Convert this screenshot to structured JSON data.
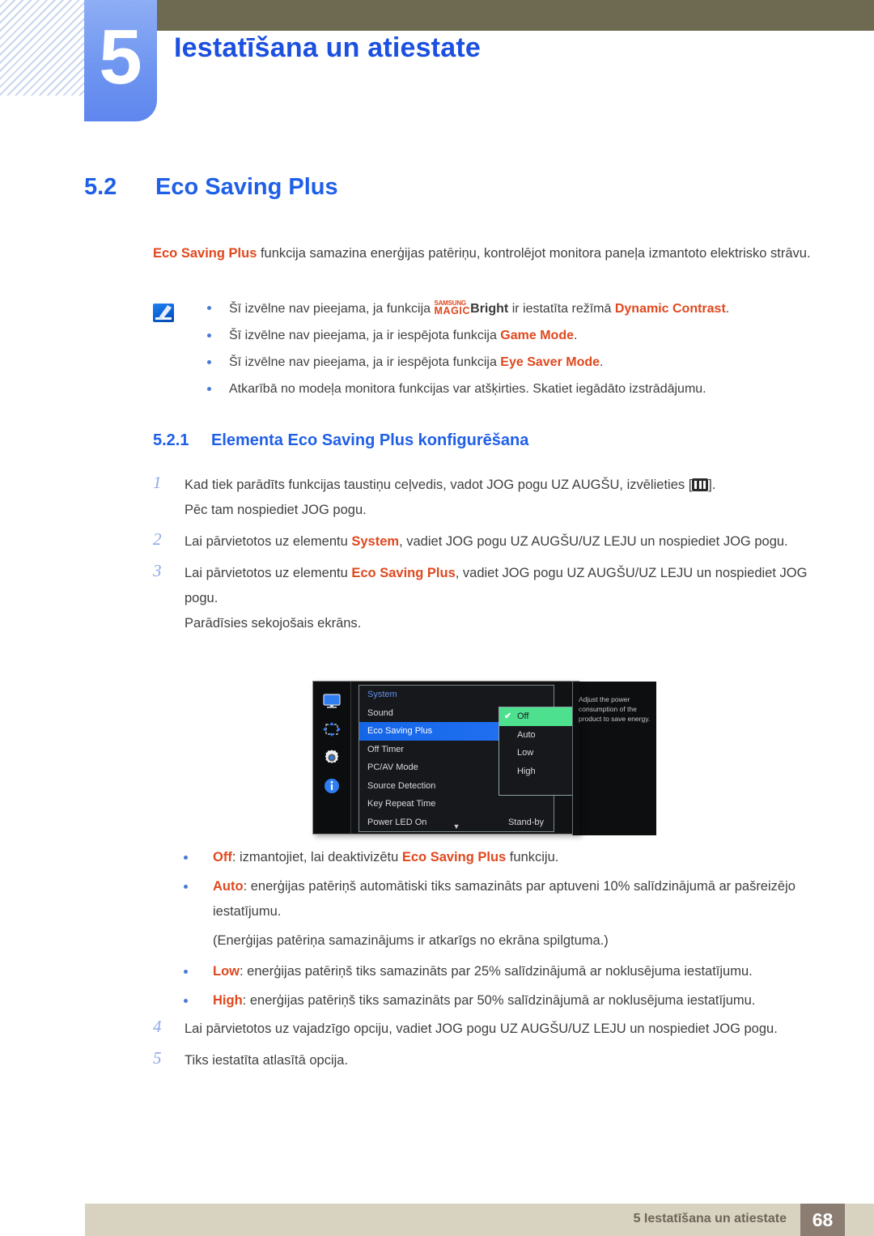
{
  "header": {
    "chapter_number": "5",
    "chapter_title": "Iestatīšana un atiestate"
  },
  "section": {
    "number": "5.2",
    "title": "Eco Saving Plus"
  },
  "intro": {
    "keyword": "Eco Saving Plus",
    "rest": " funkcija samazina enerģijas patēriņu, kontrolējot monitora paneļa izmantoto elektrisko strāvu."
  },
  "notes": [
    {
      "pre": "Šī izvēlne nav pieejama, ja funkcija ",
      "logo_top": "SAMSUNG",
      "logo_bottom": "MAGIC",
      "logo_suffix": "Bright",
      "mid": " ir iestatīta režīmā ",
      "kw": "Dynamic Contrast",
      "post": "."
    },
    {
      "pre": "Šī izvēlne nav pieejama, ja ir iespējota funkcija ",
      "kw": "Game Mode",
      "post": "."
    },
    {
      "pre": "Šī izvēlne nav pieejama, ja ir iespējota funkcija ",
      "kw": "Eye Saver Mode",
      "post": "."
    },
    {
      "pre": "Atkarībā no modeļa monitora funkcijas var atšķirties. Skatiet iegādāto izstrādājumu.",
      "kw": "",
      "post": ""
    }
  ],
  "subsection": {
    "number": "5.2.1",
    "title": "Elementa Eco Saving Plus konfigurēšana"
  },
  "steps": [
    {
      "index": "1",
      "pre": "Kad tiek parādīts funkcijas taustiņu ceļvedis, vadot JOG pogu UZ AUGŠU, izvēlieties [",
      "kw": "",
      "post": "].",
      "has_glyph": true,
      "extra": "Pēc tam nospiediet JOG pogu."
    },
    {
      "index": "2",
      "pre": "Lai pārvietotos uz elementu ",
      "kw": "System",
      "post": ", vadiet JOG pogu UZ AUGŠU/UZ LEJU un nospiediet JOG pogu.",
      "has_glyph": false,
      "extra": ""
    },
    {
      "index": "3",
      "pre": "Lai pārvietotos uz elementu ",
      "kw": "Eco Saving Plus",
      "post": ", vadiet JOG pogu UZ AUGŠU/UZ LEJU un nospiediet JOG pogu.",
      "has_glyph": false,
      "extra": "Parādīsies sekojošais ekrāns."
    }
  ],
  "osd": {
    "rail_icons": [
      "monitor-icon",
      "move-arrows-icon",
      "gear-icon",
      "info-icon"
    ],
    "menu_header": "System",
    "rows": [
      {
        "label": "Sound",
        "value": "",
        "active": false
      },
      {
        "label": "Eco Saving Plus",
        "value": "",
        "active": true
      },
      {
        "label": "Off Timer",
        "value": "",
        "active": false
      },
      {
        "label": "PC/AV Mode",
        "value": "",
        "active": false
      },
      {
        "label": "Source Detection",
        "value": "",
        "active": false
      },
      {
        "label": "Key Repeat Time",
        "value": "",
        "active": false
      },
      {
        "label": "Power LED On",
        "value": "Stand-by",
        "active": false
      }
    ],
    "scroll_indicator": "▼",
    "submenu": [
      {
        "label": "Off",
        "selected": true,
        "check": "✔"
      },
      {
        "label": "Auto",
        "selected": false,
        "check": ""
      },
      {
        "label": "Low",
        "selected": false,
        "check": ""
      },
      {
        "label": "High",
        "selected": false,
        "check": ""
      }
    ],
    "description": "Adjust the power consumption of the product to save energy.",
    "colors": {
      "highlight_blue": "#1f6ff0",
      "selected_green": "#4ce08f",
      "background": "#17181b"
    }
  },
  "options": [
    {
      "kw": "Off",
      "pre": ": izmantojiet, lai deaktivizētu ",
      "kw2": "Eco Saving Plus",
      "post": " funkciju.",
      "sub": ""
    },
    {
      "kw": "Auto",
      "pre": ": enerģijas patēriņš automātiski tiks samazināts par aptuveni 10% salīdzinājumā ar pašreizējo iestatījumu.",
      "kw2": "",
      "post": "",
      "sub": "(Enerģijas patēriņa samazinājums ir atkarīgs no ekrāna spilgtuma.)"
    },
    {
      "kw": "Low",
      "pre": ": enerģijas patēriņš tiks samazināts par 25% salīdzinājumā ar noklusējuma iestatījumu.",
      "kw2": "",
      "post": "",
      "sub": ""
    },
    {
      "kw": "High",
      "pre": ": enerģijas patēriņš tiks samazināts par 50% salīdzinājumā ar noklusējuma iestatījumu.",
      "kw2": "",
      "post": "",
      "sub": ""
    }
  ],
  "steps_end": [
    {
      "index": "4",
      "text": "Lai pārvietotos uz vajadzīgo opciju, vadiet JOG pogu UZ AUGŠU/UZ LEJU un nospiediet JOG pogu."
    },
    {
      "index": "5",
      "text": "Tiks iestatīta atlasītā opcija."
    }
  ],
  "footer": {
    "text": "5 Iestatīšana un atiestate",
    "page": "68"
  },
  "colors": {
    "heading_blue": "#1f5fe8",
    "keyword_orange": "#e0481e",
    "olive_bar": "#6e6a51",
    "footer_beige": "#d8d3c0",
    "footer_brown": "#8b7d72"
  }
}
